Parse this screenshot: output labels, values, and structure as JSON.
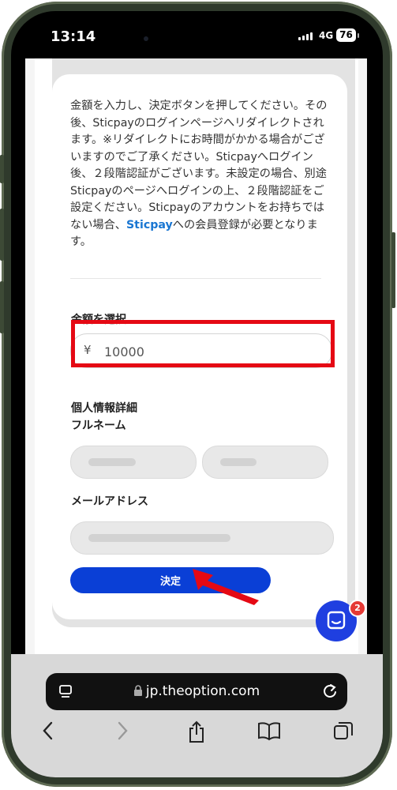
{
  "status_bar": {
    "time": "13:14",
    "network": "4G",
    "battery": "76"
  },
  "intro": {
    "text_before_link": "金額を入力し、決定ボタンを押してください。その後、Sticpayのログインページへリダイレクトされます。※リダイレクトにお時間がかかる場合がございますのでご了承ください。Sticpayへログイン後、２段階認証がございます。未設定の場合、別途Sticpayのページへログインの上、２段階認証をご設定ください。Sticpayのアカウントをお持ちではない場合、",
    "link": "Sticpay",
    "text_after_link": "への会員登録が必要となります。"
  },
  "amount": {
    "label": "金額を選択",
    "currency": "¥",
    "value": "10000"
  },
  "personal": {
    "section_label": "個人情報詳細",
    "fullname_label": "フルネーム",
    "email_label": "メールアドレス"
  },
  "submit": {
    "label": "決定"
  },
  "chat": {
    "badge_count": "2"
  },
  "browser": {
    "url": "jp.theoption.com"
  },
  "colors": {
    "accent": "#0a3fd6",
    "highlight": "#e50914",
    "arrow": "#e50914",
    "link": "#1976d2"
  },
  "icons": {
    "tab_icon": "tab-overview-icon",
    "lock_icon": "lock-icon",
    "reload_icon": "reload-icon",
    "back": "chevron-left-icon",
    "forward": "chevron-right-icon",
    "share": "share-icon",
    "bookmarks": "book-icon",
    "tabs": "tabs-icon",
    "chat": "chat-icon",
    "annotation": "red-arrow-icon"
  }
}
